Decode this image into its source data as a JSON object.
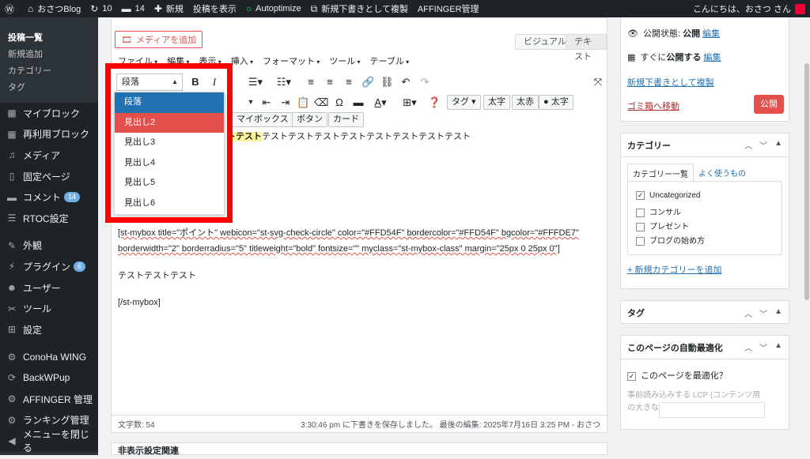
{
  "adminbar": {
    "site": "おさつBlog",
    "updates": "10",
    "comments": "14",
    "new": "新規",
    "view": "投稿を表示",
    "autoptimize": "Autoptimize",
    "duplicate": "新規下書きとして複製",
    "affinger": "AFFINGER管理",
    "greeting": "こんにちは、おさつ さん"
  },
  "sidebar": {
    "subitems": [
      "投稿一覧",
      "新規追加",
      "カテゴリー",
      "タグ"
    ],
    "items": [
      {
        "label": "マイブロック",
        "icon": "block-icon"
      },
      {
        "label": "再利用ブロック",
        "icon": "block-icon"
      },
      {
        "label": "メディア",
        "icon": "media-icon"
      },
      {
        "label": "固定ページ",
        "icon": "page-icon"
      },
      {
        "label": "コメント",
        "icon": "comment-icon",
        "badge": "14"
      },
      {
        "label": "RTOC設定",
        "icon": "list-icon"
      },
      {
        "label": "外観",
        "icon": "appearance-icon"
      },
      {
        "label": "プラグイン",
        "icon": "plugin-icon",
        "badge": "6"
      },
      {
        "label": "ユーザー",
        "icon": "user-icon"
      },
      {
        "label": "ツール",
        "icon": "tool-icon"
      },
      {
        "label": "設定",
        "icon": "settings-icon"
      },
      {
        "label": "ConoHa WING",
        "icon": "gear-icon"
      },
      {
        "label": "BackWPup",
        "icon": "backup-icon"
      },
      {
        "label": "AFFINGER 管理",
        "icon": "gear-icon"
      },
      {
        "label": "ランキング管理",
        "icon": "gear-icon"
      },
      {
        "label": "メニューを閉じる",
        "icon": "collapse-icon"
      }
    ]
  },
  "editor": {
    "add_media": "メディアを追加",
    "tab_visual": "ビジュアル",
    "tab_text": "テキスト",
    "menus": [
      "ファイル",
      "編集",
      "表示",
      "挿入",
      "フォーマット",
      "ツール",
      "テーブル"
    ],
    "format_value": "段落",
    "dropdown": [
      "段落",
      "見出し2",
      "見出し3",
      "見出し4",
      "見出し5",
      "見出し6"
    ],
    "chip_tag": "タグ",
    "chip_bold": "太字",
    "chip_boldred": "太赤",
    "chip_circle": "太字",
    "chip_mybox": "マイボックス",
    "chip_button": "ボタン",
    "chip_card": "カード",
    "line1": "テストテストテストテストテストテストテストテスト",
    "line1_hl": "トテスト",
    "shortcode": "[st-mybox title=\"ポイント\" webicon=\"st-svg-check-circle\" color=\"#FFD54F\" bordercolor=\"#FFD54F\" bgcolor=\"#FFFDE7\" borderwidth=\"2\" borderradius=\"5\" titleweight=\"bold\" fontsize=\"\" myclass=\"st-mybox-class\" margin=\"25px 0 25px 0\"]",
    "body": "テストテストテスト",
    "close": "[/st-mybox]",
    "wordcount": "文字数: 54",
    "saved": "3:30:46 pm に下書きを保存しました。 最後の編集: 2025年7月16日 3:25 PM - おさつ"
  },
  "publish": {
    "status_label": "公開状態:",
    "status_value": "公開",
    "edit": "編集",
    "schedule_label": "すぐに",
    "schedule_value": "公開する",
    "dup": "新規下書きとして複製",
    "trash": "ゴミ箱へ移動",
    "publish_btn": "公開"
  },
  "categories": {
    "title": "カテゴリー",
    "tab_all": "カテゴリー一覧",
    "tab_pop": "よく使うもの",
    "items": [
      {
        "label": "Uncategorized",
        "checked": true
      },
      {
        "label": "コンサル",
        "checked": false
      },
      {
        "label": "プレゼント",
        "checked": false
      },
      {
        "label": "ブログの始め方",
        "checked": false
      }
    ],
    "add": "+ 新規カテゴリーを追加"
  },
  "tags": {
    "title": "タグ"
  },
  "optimize": {
    "title": "このページの自動最適化",
    "check": "このページを最適化？",
    "lcp": "事前読み込みする LCP (コンテンツ用の大きな) 画像"
  },
  "bottom": {
    "title": "非表示設定関連"
  },
  "colors": {
    "accent": "#e3504b",
    "blue": "#2271b1",
    "admin": "#1d2327"
  }
}
